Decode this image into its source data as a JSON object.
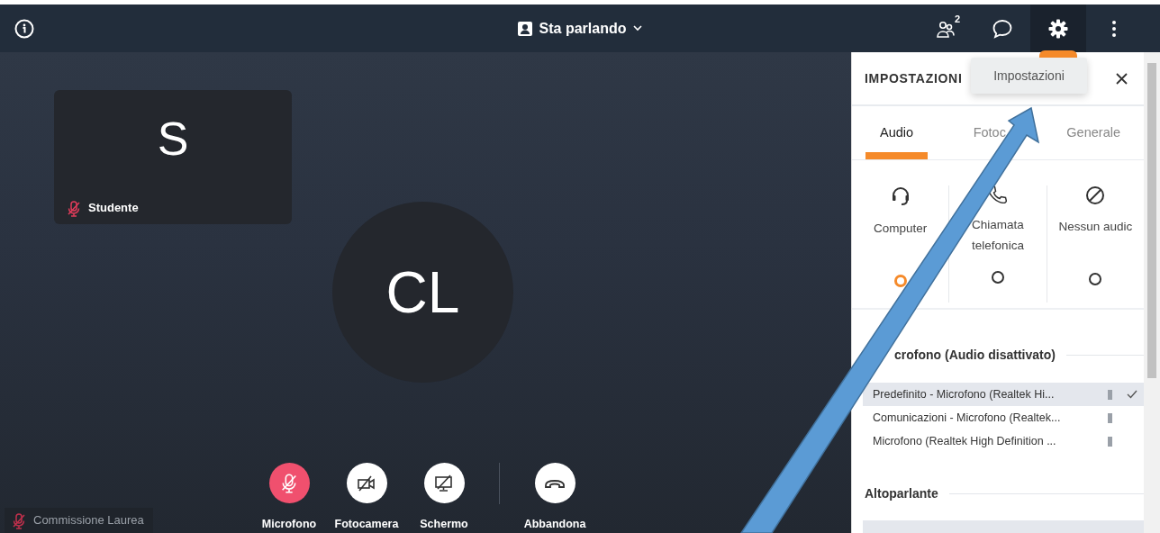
{
  "top_bar": {
    "view_label": "Sta parlando",
    "participants_count": "2",
    "tools": [
      {
        "kind": "participants",
        "selected": false
      },
      {
        "kind": "chat",
        "selected": false
      },
      {
        "kind": "settings",
        "selected": true
      },
      {
        "kind": "more",
        "selected": false
      }
    ]
  },
  "stage": {
    "tile": {
      "initial": "S",
      "name": "Studente",
      "muted": true
    },
    "speaker_initials": "CL",
    "self_name": "Commissione Laurea",
    "self_muted": true,
    "controls": [
      {
        "kind": "mic",
        "label": "Microfono",
        "highlighted": true
      },
      {
        "kind": "camera",
        "label": "Fotocamera",
        "highlighted": false
      },
      {
        "kind": "screen",
        "label": "Schermo",
        "highlighted": false
      },
      {
        "kind": "leave",
        "label": "Abbandona",
        "highlighted": false
      }
    ]
  },
  "settings_panel": {
    "title": "IMPOSTAZIONI",
    "tooltip": "Impostazioni",
    "tabs": [
      {
        "label": "Audio",
        "selected": true
      },
      {
        "label": "Fotoc",
        "selected": false
      },
      {
        "label": "Generale",
        "selected": false
      }
    ],
    "audio_options": [
      {
        "kind": "headset",
        "label": "Computer",
        "selected": true
      },
      {
        "kind": "phone",
        "label": "Chiamata telefonica",
        "selected": false
      },
      {
        "kind": "none",
        "label": "Nessun audic",
        "selected": false
      }
    ],
    "microphone_heading": "crofono  (Audio disattivato)",
    "microphones": [
      {
        "label": "Predefinito - Microfono (Realtek Hi...",
        "selected": true
      },
      {
        "label": "Comunicazioni - Microfono (Realtek...",
        "selected": false
      },
      {
        "label": "Microfono (Realtek High Definition ...",
        "selected": false
      }
    ],
    "speaker_heading": "Altoparlante"
  }
}
